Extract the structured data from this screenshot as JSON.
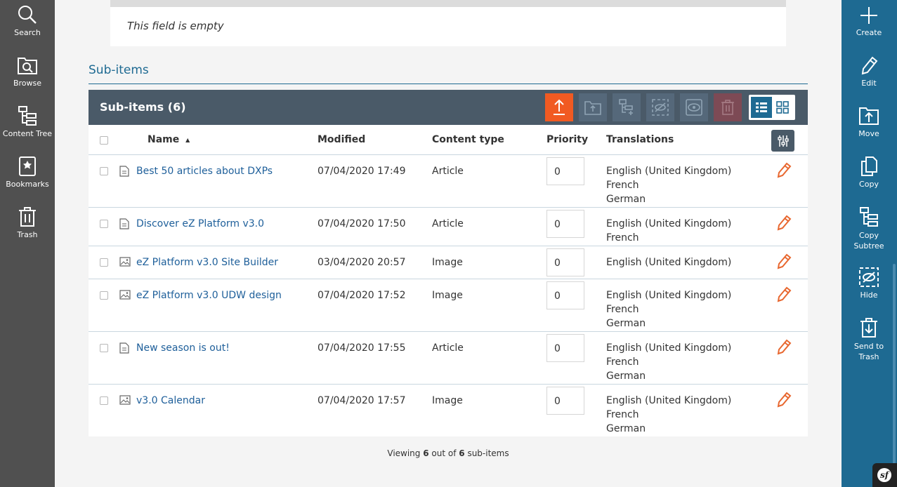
{
  "left_sidebar": {
    "items": [
      {
        "label": "Search",
        "icon": "search-icon"
      },
      {
        "label": "Browse",
        "icon": "browse-icon"
      },
      {
        "label": "Content Tree",
        "icon": "content-tree-icon"
      },
      {
        "label": "Bookmarks",
        "icon": "bookmark-icon"
      },
      {
        "label": "Trash",
        "icon": "trash-icon"
      }
    ]
  },
  "right_sidebar": {
    "items": [
      {
        "label": "Create",
        "icon": "plus-icon"
      },
      {
        "label": "Edit",
        "icon": "pencil-icon"
      },
      {
        "label": "Move",
        "icon": "move-icon"
      },
      {
        "label": "Copy",
        "icon": "copy-icon"
      },
      {
        "label": "Copy Subtree",
        "icon": "copy-subtree-icon"
      },
      {
        "label": "Hide",
        "icon": "hide-icon"
      },
      {
        "label": "Send to Trash",
        "icon": "send-to-trash-icon"
      }
    ]
  },
  "empty_field": {
    "text": "This field is empty"
  },
  "subitems": {
    "section_title": "Sub-items",
    "panel_title": "Sub-items (6)",
    "columns": {
      "name": "Name",
      "sort_indicator": "▲",
      "modified": "Modified",
      "content_type": "Content type",
      "priority": "Priority",
      "translations": "Translations"
    },
    "rows": [
      {
        "name": "Best 50 articles about DXPs",
        "modified": "07/04/2020 17:49",
        "content_type": "Article",
        "priority": "0",
        "translations": [
          "English (United Kingdom)",
          "French",
          "German"
        ]
      },
      {
        "name": "Discover eZ Platform v3.0",
        "modified": "07/04/2020 17:50",
        "content_type": "Article",
        "priority": "0",
        "translations": [
          "English (United Kingdom)",
          "French"
        ]
      },
      {
        "name": "eZ Platform v3.0 Site Builder",
        "modified": "03/04/2020 20:57",
        "content_type": "Image",
        "priority": "0",
        "translations": [
          "English (United Kingdom)"
        ]
      },
      {
        "name": "eZ Platform v3.0 UDW design",
        "modified": "07/04/2020 17:52",
        "content_type": "Image",
        "priority": "0",
        "translations": [
          "English (United Kingdom)",
          "French",
          "German"
        ]
      },
      {
        "name": "New season is out!",
        "modified": "07/04/2020 17:55",
        "content_type": "Article",
        "priority": "0",
        "translations": [
          "English (United Kingdom)",
          "French",
          "German"
        ]
      },
      {
        "name": "v3.0 Calendar",
        "modified": "07/04/2020 17:57",
        "content_type": "Image",
        "priority": "0",
        "translations": [
          "English (United Kingdom)",
          "French",
          "German"
        ]
      }
    ],
    "footer": {
      "prefix": "Viewing ",
      "shown": "6",
      "middle": " out of ",
      "total": "6",
      "suffix": " sub-items"
    }
  },
  "colors": {
    "accent": "#1e6a92",
    "primary_action": "#f15a22",
    "left_rail": "#505050",
    "panel_header": "#4a5a68",
    "link": "#1e5f9a"
  }
}
